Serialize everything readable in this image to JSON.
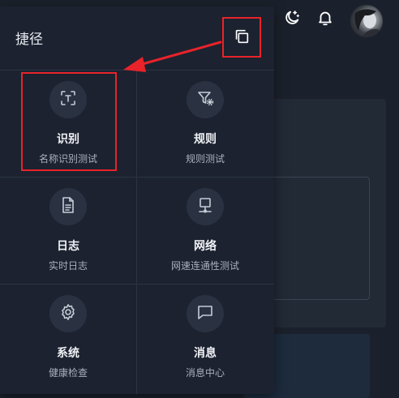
{
  "header": {
    "icons": [
      "moon-star-icon",
      "bell-icon"
    ],
    "avatar": "avatar"
  },
  "shortcut": {
    "title": "捷径",
    "copy_icon": "copy-icon",
    "items": [
      {
        "label": "识别",
        "desc": "名称识别测试",
        "icon": "scan-text-icon"
      },
      {
        "label": "规则",
        "desc": "规则测试",
        "icon": "filter-settings-icon"
      },
      {
        "label": "日志",
        "desc": "实时日志",
        "icon": "document-icon"
      },
      {
        "label": "网络",
        "desc": "网速连通性测试",
        "icon": "network-icon"
      },
      {
        "label": "系统",
        "desc": "健康检查",
        "icon": "gear-icon"
      },
      {
        "label": "消息",
        "desc": "消息中心",
        "icon": "message-icon"
      }
    ]
  },
  "colors": {
    "annotation": "#e8232a",
    "panel": "#1c2230",
    "icon_circle": "#2a3242"
  }
}
